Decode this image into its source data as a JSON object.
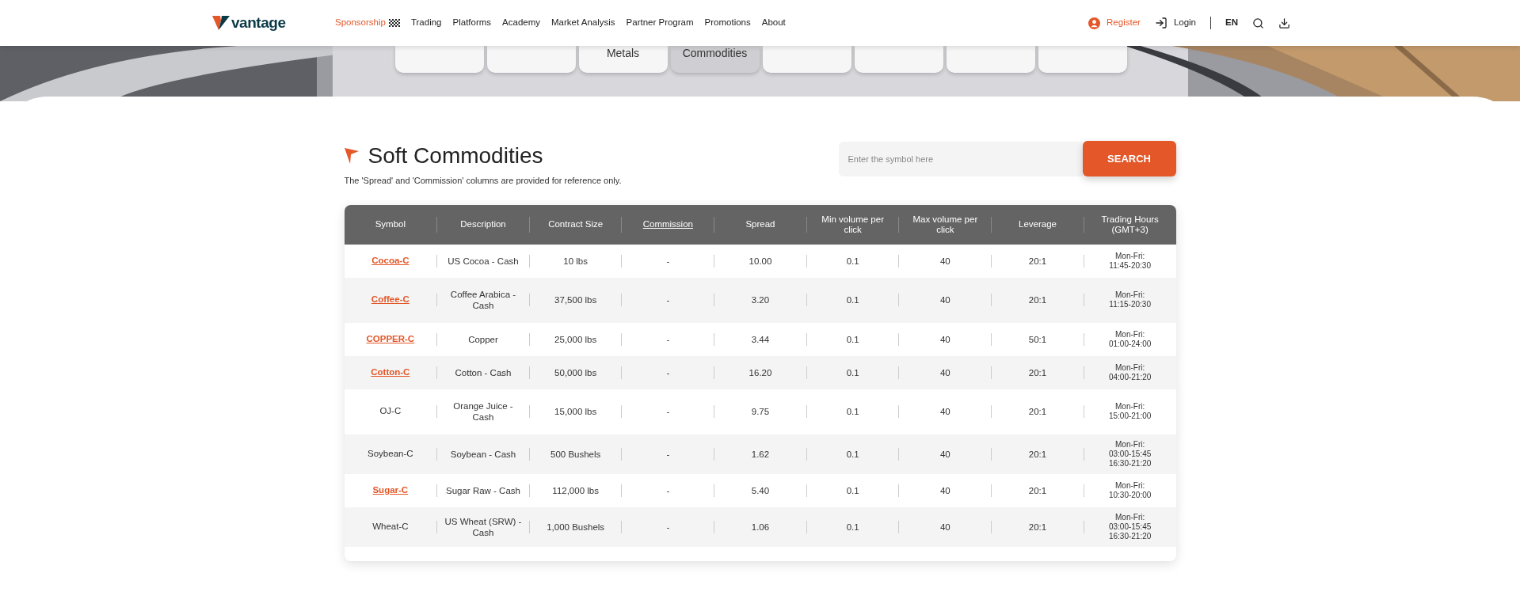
{
  "header": {
    "logo": "vantage",
    "nav": [
      {
        "label": "Sponsorship",
        "selected": true
      },
      {
        "label": "Trading",
        "selected": false
      },
      {
        "label": "Platforms",
        "selected": false
      },
      {
        "label": "Academy",
        "selected": false
      },
      {
        "label": "Market Analysis",
        "selected": false
      },
      {
        "label": "Partner Program",
        "selected": false
      },
      {
        "label": "Promotions",
        "selected": false
      },
      {
        "label": "About",
        "selected": false
      }
    ],
    "register": "Register",
    "login": "Login",
    "language": "EN"
  },
  "category_tabs": [
    {
      "selected": false
    },
    {
      "selected": false
    },
    {
      "label": "Metals",
      "selected": false
    },
    {
      "label": "Commodities",
      "selected": true
    },
    {
      "selected": false
    },
    {
      "selected": false
    },
    {
      "selected": false
    },
    {
      "selected": false
    }
  ],
  "title": "Soft Commodities",
  "note": "The 'Spread' and 'Commission' columns are provided for reference only.",
  "search": {
    "placeholder": "Enter the symbol here",
    "button": "SEARCH"
  },
  "table": {
    "columns": [
      {
        "label": "Symbol",
        "linked": false
      },
      {
        "label": "Description",
        "linked": false
      },
      {
        "label": "Contract Size",
        "linked": false
      },
      {
        "label": "Commission",
        "linked": true
      },
      {
        "label": "Spread",
        "linked": false
      },
      {
        "label": "Min volume per click",
        "linked": false
      },
      {
        "label": "Max volume per click",
        "linked": false
      },
      {
        "label": "Leverage",
        "linked": false
      },
      {
        "label": "Trading Hours (GMT+3)",
        "linked": false
      }
    ],
    "rows": [
      {
        "linked": true,
        "cells": [
          "Cocoa-C",
          "US Cocoa - Cash",
          "10 lbs",
          "-",
          "10.00",
          "0.1",
          "40",
          "20:1",
          "Mon-Fri: 11:45-20:30"
        ]
      },
      {
        "linked": true,
        "cells": [
          "Coffee-C",
          "Coffee Arabica - Cash",
          "37,500 lbs",
          "-",
          "3.20",
          "0.1",
          "40",
          "20:1",
          "Mon-Fri: 11:15-20:30"
        ]
      },
      {
        "linked": true,
        "cells": [
          "COPPER-C",
          "Copper",
          "25,000 lbs",
          "-",
          "3.44",
          "0.1",
          "40",
          "50:1",
          "Mon-Fri: 01:00-24:00"
        ]
      },
      {
        "linked": true,
        "cells": [
          "Cotton-C",
          "Cotton - Cash",
          "50,000 lbs",
          "-",
          "16.20",
          "0.1",
          "40",
          "20:1",
          "Mon-Fri: 04:00-21:20"
        ]
      },
      {
        "linked": false,
        "cells": [
          "OJ-C",
          "Orange Juice - Cash",
          "15,000 lbs",
          "-",
          "9.75",
          "0.1",
          "40",
          "20:1",
          "Mon-Fri: 15:00-21:00"
        ]
      },
      {
        "linked": false,
        "cells": [
          "Soybean-C",
          "Soybean - Cash",
          "500 Bushels",
          "-",
          "1.62",
          "0.1",
          "40",
          "20:1",
          "Mon-Fri: 03:00-15:45 16:30-21:20"
        ]
      },
      {
        "linked": true,
        "cells": [
          "Sugar-C",
          "Sugar Raw - Cash",
          "112,000 lbs",
          "-",
          "5.40",
          "0.1",
          "40",
          "20:1",
          "Mon-Fri: 10:30-20:00"
        ]
      },
      {
        "linked": false,
        "cells": [
          "Wheat-C",
          "US Wheat (SRW) - Cash",
          "1,000 Bushels",
          "-",
          "1.06",
          "0.1",
          "40",
          "20:1",
          "Mon-Fri: 03:00-15:45 16:30-21:20"
        ]
      }
    ]
  }
}
